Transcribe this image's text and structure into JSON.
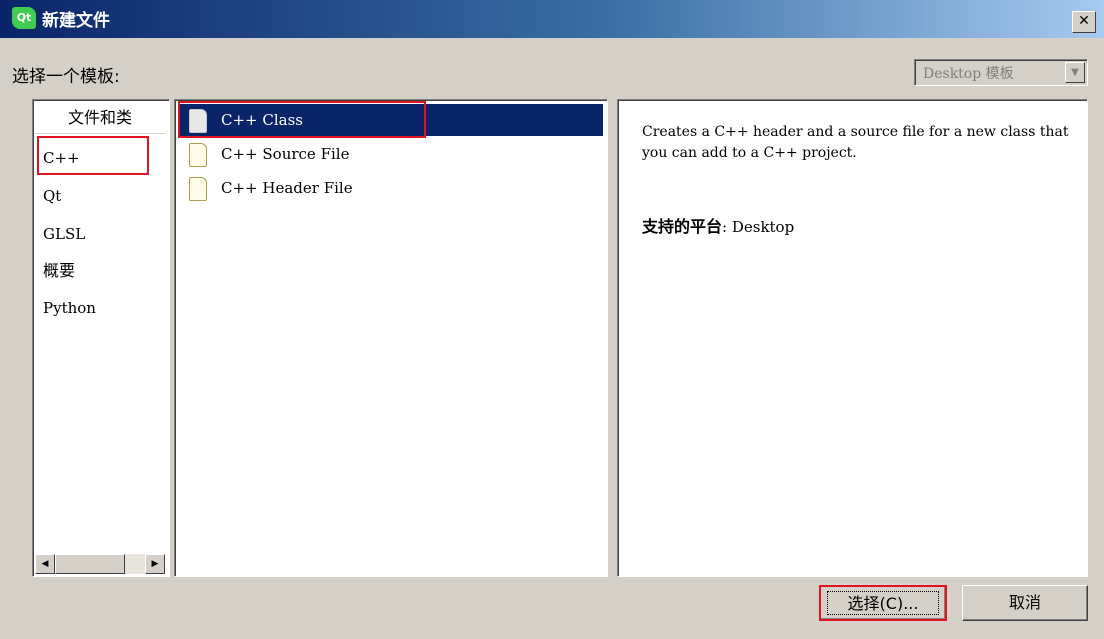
{
  "window": {
    "title": "新建文件",
    "app_icon_text": "Qt"
  },
  "header": {
    "choose_label": "选择一个模板:",
    "platform_combo": "Desktop 模板"
  },
  "categories": {
    "header": "文件和类",
    "items": [
      "C++",
      "Qt",
      "GLSL",
      "概要",
      "Python"
    ],
    "selected": "C++"
  },
  "templates": {
    "items": [
      {
        "label": "C++ Class",
        "selected": true
      },
      {
        "label": "C++ Source File",
        "selected": false
      },
      {
        "label": "C++ Header File",
        "selected": false
      }
    ]
  },
  "description": {
    "text": "Creates a C++ header and a source file for a new class that you can add to a C++ project.",
    "platform_label": "支持的平台",
    "platform_value": ": Desktop"
  },
  "buttons": {
    "select": "选择(C)...",
    "cancel": "取消"
  },
  "colors": {
    "selection": "#0a246a",
    "annotation_red": "#e0141e",
    "dialog_bg": "#d4d0c8"
  }
}
